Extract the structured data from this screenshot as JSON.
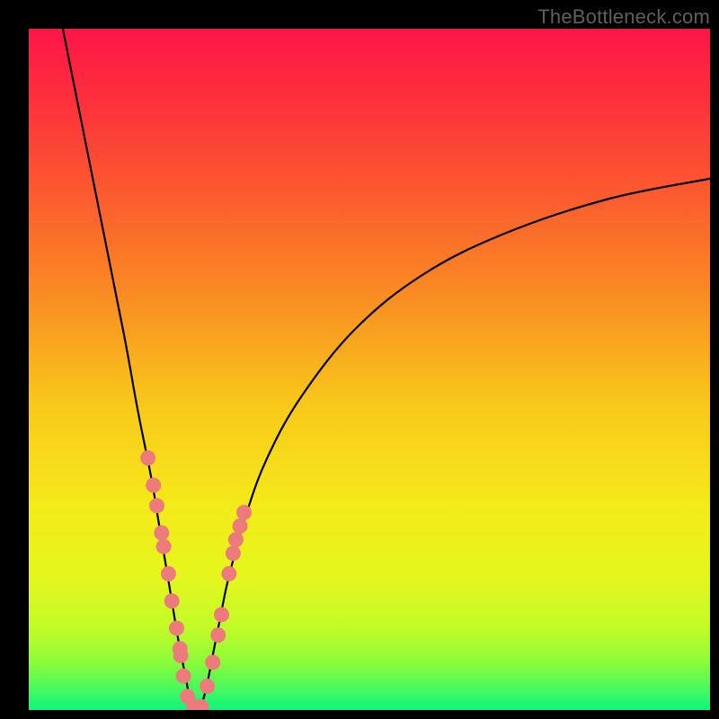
{
  "watermark": "TheBottleneck.com",
  "colors": {
    "curve": "#000000",
    "marker_fill": "#ee7b7b",
    "marker_stroke": "#d86a6a",
    "gradient_stops": [
      {
        "offset": 0.0,
        "color": "#fd1648"
      },
      {
        "offset": 0.1,
        "color": "#fd2f3c"
      },
      {
        "offset": 0.25,
        "color": "#fb5d2e"
      },
      {
        "offset": 0.4,
        "color": "#f98f22"
      },
      {
        "offset": 0.55,
        "color": "#f9c81a"
      },
      {
        "offset": 0.7,
        "color": "#f4ea19"
      },
      {
        "offset": 0.8,
        "color": "#e6f61c"
      },
      {
        "offset": 0.88,
        "color": "#c2fb28"
      },
      {
        "offset": 0.93,
        "color": "#8cfc3a"
      },
      {
        "offset": 0.97,
        "color": "#46f95e"
      },
      {
        "offset": 1.0,
        "color": "#0ff57f"
      }
    ]
  },
  "chart_data": {
    "type": "line",
    "title": "",
    "xlabel": "",
    "ylabel": "",
    "xlim": [
      0,
      100
    ],
    "ylim": [
      0,
      100
    ],
    "note": "Approximate V-shaped bottleneck curve; y≈100 is top (red), y≈0 is bottom (green). Minimum near x≈24.",
    "series": [
      {
        "name": "bottleneck-curve",
        "x": [
          5,
          8,
          11,
          14,
          16,
          18,
          19,
          20,
          21,
          22,
          23,
          24,
          25,
          26,
          27,
          28,
          29,
          30,
          32,
          35,
          40,
          48,
          58,
          70,
          85,
          100
        ],
        "y": [
          100,
          85,
          70,
          55,
          44,
          34,
          28,
          22,
          16,
          10,
          5,
          0,
          0,
          3,
          8,
          13,
          18,
          22,
          29,
          37,
          46,
          56,
          64,
          70,
          75,
          78
        ]
      }
    ],
    "markers": {
      "name": "highlighted-points",
      "x": [
        17.5,
        18.3,
        18.8,
        19.5,
        19.8,
        20.5,
        21.0,
        21.7,
        22.2,
        22.3,
        22.7,
        23.3,
        24.2,
        25.3,
        26.2,
        27.0,
        27.8,
        28.3,
        29.4,
        30.0,
        30.4,
        31.0,
        31.6
      ],
      "y": [
        37,
        33,
        30,
        26,
        24,
        20,
        16,
        12,
        9,
        8,
        5,
        2,
        0.5,
        0.5,
        3.5,
        7,
        11,
        14,
        20,
        23,
        25,
        27,
        29
      ]
    }
  }
}
